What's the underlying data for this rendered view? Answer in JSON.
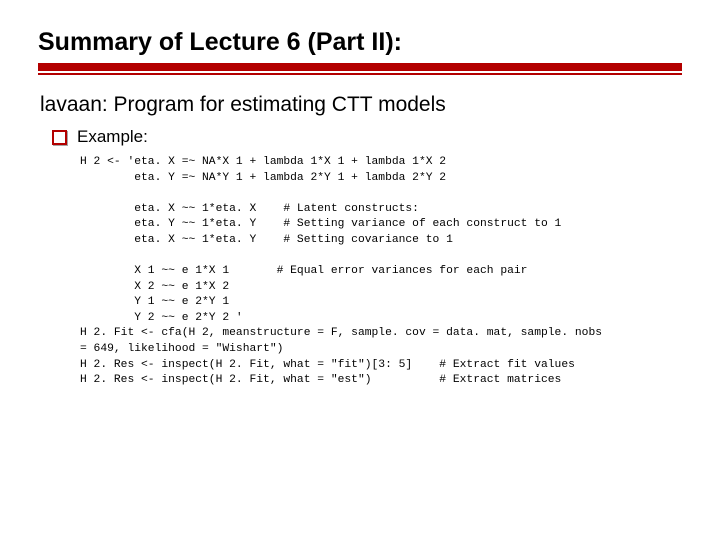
{
  "title": "Summary of Lecture 6 (Part II):",
  "subtitle": "lavaan: Program for estimating CTT models",
  "bullet": "Example:",
  "code": "H 2 <- 'eta. X =~ NA*X 1 + lambda 1*X 1 + lambda 1*X 2\n        eta. Y =~ NA*Y 1 + lambda 2*Y 1 + lambda 2*Y 2\n\n        eta. X ~~ 1*eta. X    # Latent constructs:\n        eta. Y ~~ 1*eta. Y    # Setting variance of each construct to 1\n        eta. X ~~ 1*eta. Y    # Setting covariance to 1\n\n        X 1 ~~ e 1*X 1       # Equal error variances for each pair\n        X 2 ~~ e 1*X 2\n        Y 1 ~~ e 2*Y 1\n        Y 2 ~~ e 2*Y 2 '\nH 2. Fit <- cfa(H 2, meanstructure = F, sample. cov = data. mat, sample. nobs\n= 649, likelihood = \"Wishart\")\nH 2. Res <- inspect(H 2. Fit, what = \"fit\")[3: 5]    # Extract fit values\nH 2. Res <- inspect(H 2. Fit, what = \"est\")          # Extract matrices"
}
